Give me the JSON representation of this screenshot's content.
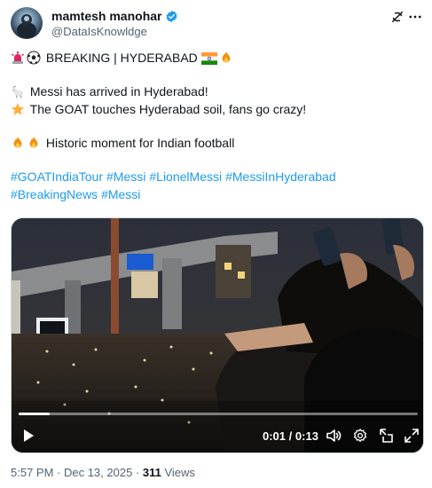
{
  "author": {
    "display_name": "mamtesh manohar",
    "handle": "@DataIsKnowldge",
    "verified": true
  },
  "tweet": {
    "lines": [
      {
        "emojis": [
          "siren-emoji",
          "soccer-ball-emoji"
        ],
        "text": "BREAKING | HYDERABAD",
        "trailing_emojis": [
          "india-flag-emoji",
          "fire-emoji"
        ]
      },
      {
        "emojis": [
          "goat-emoji"
        ],
        "text": "Messi has arrived in Hyderabad!"
      },
      {
        "emojis": [
          "star-emoji"
        ],
        "text": "The GOAT touches Hyderabad soil, fans go crazy!"
      },
      {
        "emojis": [
          "fire-emoji",
          "fire-emoji"
        ],
        "text": "Historic moment for Indian football"
      }
    ],
    "hashtags_line1": [
      "#GOATIndiaTour",
      "#Messi",
      "#LionelMessi",
      "#MessiInHyderabad"
    ],
    "hashtags_line2": [
      "#BreakingNews",
      "#Messi"
    ]
  },
  "video": {
    "current_time": "0:01",
    "separator": "/",
    "duration": "0:13",
    "progress_fraction": 0.077
  },
  "meta": {
    "timestamp": "5:57 PM · Dec 13, 2025 ·",
    "views_count": "311",
    "views_label": "Views"
  },
  "colors": {
    "link": "#1d9bf0",
    "secondary_text": "#536471",
    "verified_badge": "#1d9bf0"
  },
  "icons": [
    "grok-icon",
    "more-icon",
    "play-icon",
    "volume-icon",
    "settings-icon",
    "pip-icon",
    "fullscreen-icon"
  ]
}
